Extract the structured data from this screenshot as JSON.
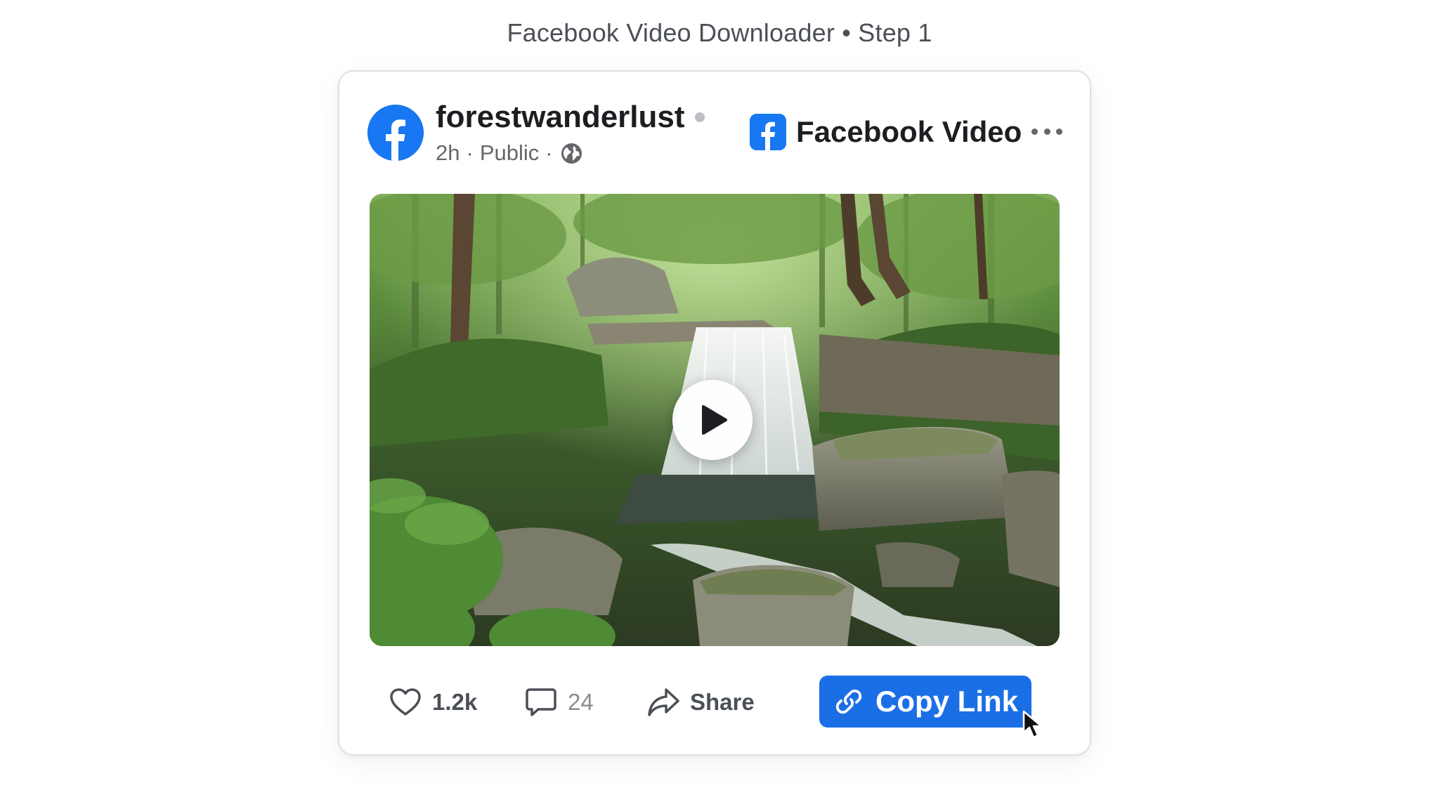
{
  "page": {
    "heading": "Facebook Video Downloader • Step 1"
  },
  "post": {
    "author": "forestwanderlust",
    "time": "2h",
    "separator": "·",
    "visibility": "Public",
    "brand_label": "Facebook Video",
    "media": {
      "subject": "Waterfall in a forest",
      "play_icon": "play-icon"
    },
    "actions": {
      "likes": "1.2k",
      "comments": "24",
      "share_label": "Share",
      "copy_link_label": "Copy Link"
    }
  },
  "colors": {
    "facebook_blue": "#1877f2",
    "button_blue": "#1b6fe6",
    "text_primary": "#1c1e21",
    "text_secondary": "#65676b"
  },
  "icons": [
    "facebook-logo-icon",
    "globe-icon",
    "more-options-icon",
    "play-icon",
    "heart-icon",
    "comment-icon",
    "share-icon",
    "link-icon",
    "cursor-icon"
  ]
}
